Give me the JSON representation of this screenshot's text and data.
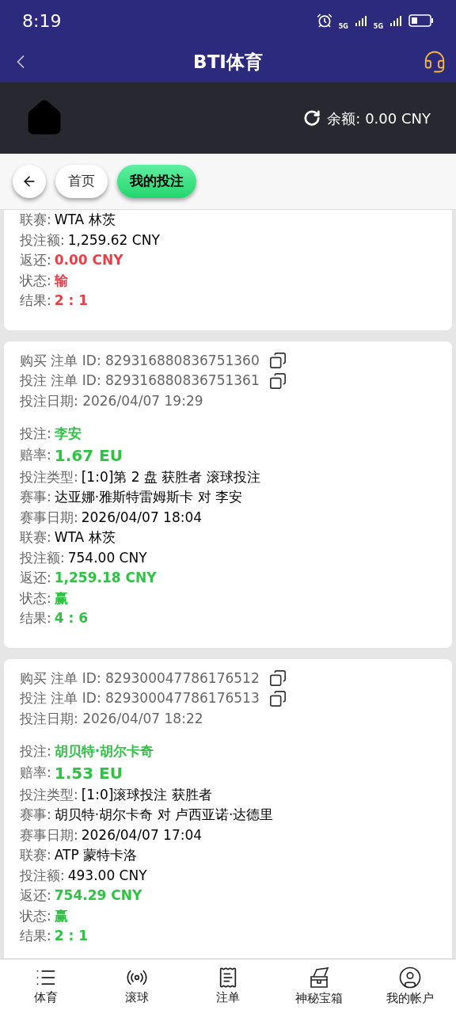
{
  "status_bar": {
    "time": "8:19",
    "network_1": "5G",
    "network_2": "5G"
  },
  "header": {
    "title": "BTI体育"
  },
  "balance": {
    "label": "余额:",
    "value": "0.00 CNY"
  },
  "nav_tabs": [
    {
      "label": "首页",
      "selected": false
    },
    {
      "label": "我的投注",
      "selected": true
    }
  ],
  "bets": [
    {
      "kind": "lose",
      "details": [
        {
          "label": "联赛:",
          "value": "WTA 林茨",
          "kind": "plain"
        },
        {
          "label": "投注额:",
          "value": "1,259.62 CNY",
          "kind": "plain"
        },
        {
          "label": "返还:",
          "value": "0.00 CNY",
          "kind": "highlight"
        },
        {
          "label": "状态:",
          "value": "输",
          "kind": "highlight"
        },
        {
          "label": "结果:",
          "value": "2 : 1",
          "kind": "highlight"
        }
      ]
    },
    {
      "kind": "win",
      "meta": [
        {
          "label": "购买 注单 ID:",
          "value": "829316880836751360",
          "copy": true
        },
        {
          "label": "投注 注单 ID:",
          "value": "829316880836751361",
          "copy": true
        },
        {
          "label": "投注日期:",
          "value": "2026/04/07 19:29",
          "copy": false
        }
      ],
      "details": [
        {
          "label": "投注:",
          "value": "李安",
          "kind": "highlight"
        },
        {
          "label": "赔率:",
          "value": "1.67 EU",
          "kind": "odds"
        },
        {
          "label": "投注类型:",
          "value": "[1:0]第 2 盘 获胜者 滚球投注",
          "kind": "plain"
        },
        {
          "label": "赛事:",
          "value": "达亚娜·雅斯特雷姆斯卡 对 李安",
          "kind": "plain"
        },
        {
          "label": "赛事日期:",
          "value": "2026/04/07 18:04",
          "kind": "plain"
        },
        {
          "label": "联赛:",
          "value": "WTA 林茨",
          "kind": "plain"
        },
        {
          "label": "投注额:",
          "value": "754.00 CNY",
          "kind": "plain"
        },
        {
          "label": "返还:",
          "value": "1,259.18 CNY",
          "kind": "highlight"
        },
        {
          "label": "状态:",
          "value": "赢",
          "kind": "highlight"
        },
        {
          "label": "结果:",
          "value": "4 : 6",
          "kind": "highlight"
        }
      ]
    },
    {
      "kind": "win",
      "meta": [
        {
          "label": "购买 注单 ID:",
          "value": "829300047786176512",
          "copy": true
        },
        {
          "label": "投注 注单 ID:",
          "value": "829300047786176513",
          "copy": true
        },
        {
          "label": "投注日期:",
          "value": "2026/04/07 18:22",
          "copy": false
        }
      ],
      "details": [
        {
          "label": "投注:",
          "value": "胡贝特·胡尔卡奇",
          "kind": "highlight"
        },
        {
          "label": "赔率:",
          "value": "1.53 EU",
          "kind": "odds"
        },
        {
          "label": "投注类型:",
          "value": "[1:0]滚球投注 获胜者",
          "kind": "plain"
        },
        {
          "label": "赛事:",
          "value": "胡贝特·胡尔卡奇 对 卢西亚诺·达德里",
          "kind": "plain"
        },
        {
          "label": "赛事日期:",
          "value": "2026/04/07 17:04",
          "kind": "plain"
        },
        {
          "label": "联赛:",
          "value": "ATP 蒙特卡洛",
          "kind": "plain"
        },
        {
          "label": "投注额:",
          "value": "493.00 CNY",
          "kind": "plain"
        },
        {
          "label": "返还:",
          "value": "754.29 CNY",
          "kind": "highlight"
        },
        {
          "label": "状态:",
          "value": "赢",
          "kind": "highlight"
        },
        {
          "label": "结果:",
          "value": "2 : 1",
          "kind": "highlight"
        }
      ]
    }
  ],
  "bottom_nav": [
    {
      "label": "体育"
    },
    {
      "label": "滚球"
    },
    {
      "label": "注单"
    },
    {
      "label": "神秘宝箱"
    },
    {
      "label": "我的帐户"
    }
  ]
}
